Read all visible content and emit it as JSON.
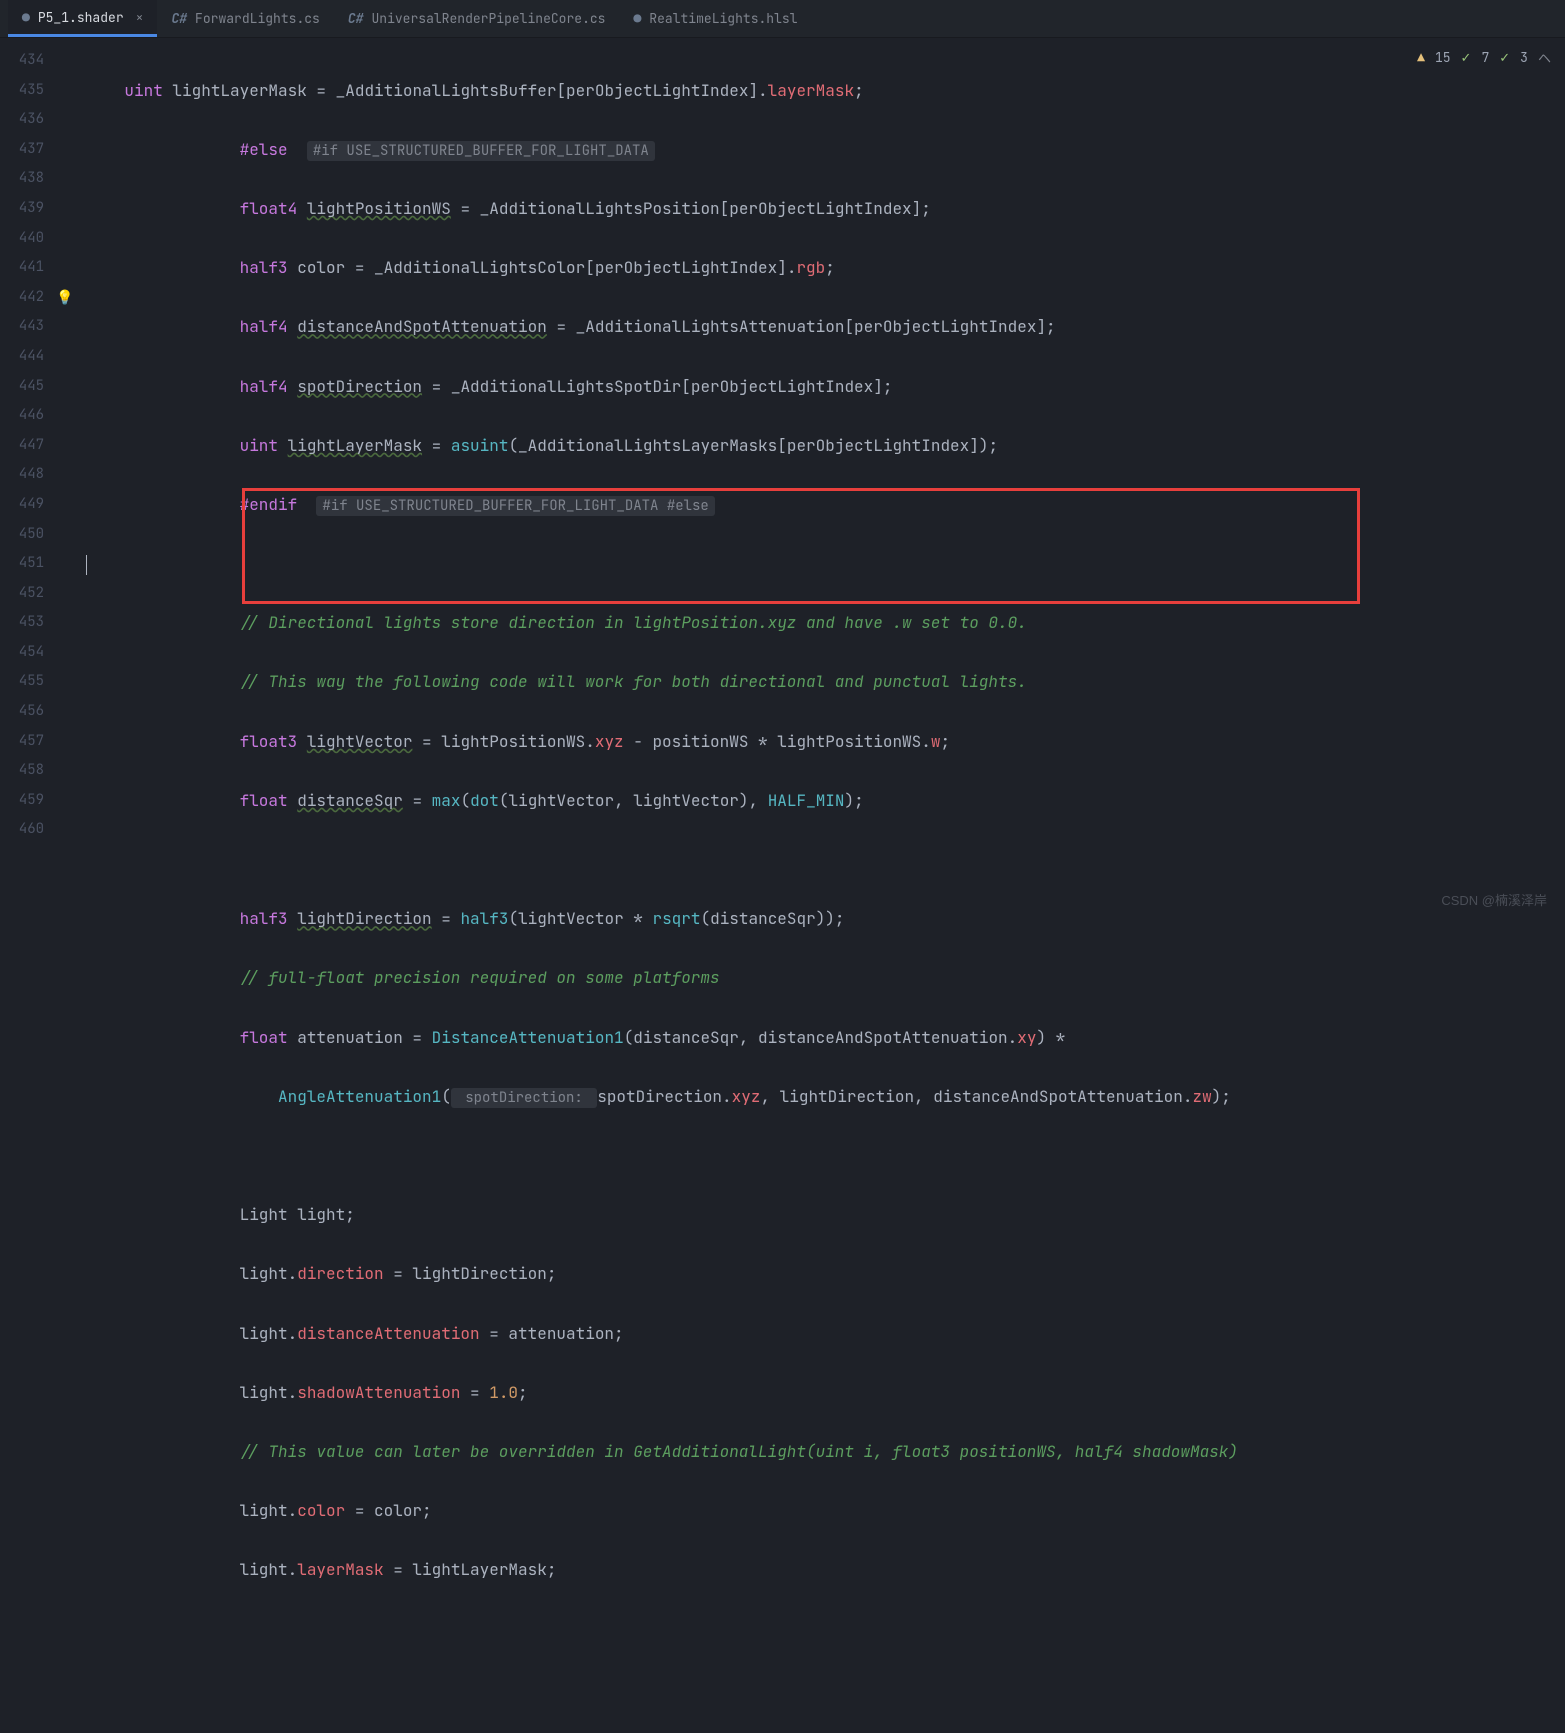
{
  "tabs": [
    {
      "label": "P5_1.shader",
      "icon": "●",
      "active": true,
      "closeable": true
    },
    {
      "label": "ForwardLights.cs",
      "icon": "C#",
      "active": false
    },
    {
      "label": "UniversalRenderPipelineCore.cs",
      "icon": "C#",
      "active": false
    },
    {
      "label": "RealtimeLights.hlsl",
      "icon": "●",
      "active": false
    }
  ],
  "status": {
    "warn_icon": "▲",
    "warn_count": "15",
    "check1_icon": "✓",
    "check1_count": "7",
    "check2_icon": "✓",
    "check2_count": "3",
    "chevron": "ヘ"
  },
  "gutter": {
    "start": 434,
    "end": 460,
    "bulb_line": 442
  },
  "code": {
    "l434": {
      "indent": "    ",
      "t1": "uint",
      "var": "lightLayerMask",
      "eq": " = ",
      "buf": "_AdditionalLightsBuffer",
      "mid": "[perObjectLightIndex].",
      "prop": "layerMask",
      "end": ";"
    },
    "l435": {
      "indent": "                ",
      "kw": "#else",
      "sp": "  ",
      "hint": "#if USE_STRUCTURED_BUFFER_FOR_LIGHT_DATA"
    },
    "l436": {
      "indent": "                ",
      "t": "float4",
      "sp": " ",
      "var": "lightPositionWS",
      "rest": " = _AdditionalLightsPosition[perObjectLightIndex];"
    },
    "l437": {
      "indent": "                ",
      "t": "half3",
      "sp": " ",
      "var": "color",
      "mid": " = _AdditionalLightsColor[perObjectLightIndex].",
      "prop": "rgb",
      "end": ";"
    },
    "l438": {
      "indent": "                ",
      "t": "half4",
      "sp": " ",
      "var": "distanceAndSpotAttenuation",
      "rest": " = _AdditionalLightsAttenuation[perObjectLightIndex];"
    },
    "l439": {
      "indent": "                ",
      "t": "half4",
      "sp": " ",
      "var": "spotDirection",
      "rest": " = _AdditionalLightsSpotDir[perObjectLightIndex];"
    },
    "l440": {
      "indent": "                ",
      "t": "uint",
      "sp": " ",
      "var": "lightLayerMask",
      "eq": " = ",
      "fn": "asuint",
      "rest": "(_AdditionalLightsLayerMasks[perObjectLightIndex]);"
    },
    "l441": {
      "indent": "                ",
      "kw": "#endif",
      "sp": "  ",
      "hint": "#if USE_STRUCTURED_BUFFER_FOR_LIGHT_DATA #else"
    },
    "l442": {
      "text": ""
    },
    "l443": {
      "indent": "                ",
      "c": "// Directional lights store direction in lightPosition.xyz and have .w set to 0.0."
    },
    "l444": {
      "indent": "                ",
      "c": "// This way the following code will work for both directional and punctual lights."
    },
    "l445": {
      "indent": "                ",
      "t": "float3",
      "sp": " ",
      "var": "lightVector",
      "mid1": " = lightPositionWS.",
      "p1": "xyz",
      "mid2": " - positionWS * lightPositionWS.",
      "p2": "w",
      "end": ";"
    },
    "l446": {
      "indent": "                ",
      "t": "float",
      "sp": " ",
      "var": "distanceSqr",
      "eq": " = ",
      "fn1": "max",
      "op": "(",
      "fn2": "dot",
      "args": "(lightVector, lightVector), ",
      "const": "HALF_MIN",
      "end": ");"
    },
    "l447": {
      "text": ""
    },
    "l448": {
      "indent": "                ",
      "t": "half3",
      "sp": " ",
      "var": "lightDirection",
      "eq": " = ",
      "fn1": "half3",
      "op": "(lightVector * ",
      "fn2": "rsqrt",
      "end": "(distanceSqr));"
    },
    "l449": {
      "indent": "                ",
      "c": "// full-float precision required on some platforms"
    },
    "l450": {
      "indent": "                ",
      "t": "float",
      "var": " attenuation = ",
      "fn": "DistanceAttenuation1",
      "args": "(distanceSqr, distanceAndSpotAttenuation.",
      "p": "xy",
      "end": ") *"
    },
    "l451": {
      "indent": "                    ",
      "fn": "AngleAttenuation1",
      "op": "(",
      "hint": " spotDirection: ",
      "args1": "spotDirection.",
      "p1": "xyz",
      "args2": ", lightDirection, distanceAndSpotAttenuation.",
      "p2": "zw",
      "end": ");"
    },
    "l452": {
      "text": ""
    },
    "l453": {
      "indent": "                ",
      "t": "Light",
      "rest": " light;"
    },
    "l454": {
      "indent": "                ",
      "pre": "light.",
      "prop": "direction",
      "rest": " = lightDirection;"
    },
    "l455": {
      "indent": "                ",
      "pre": "light.",
      "prop": "distanceAttenuation",
      "rest": " = attenuation;"
    },
    "l456": {
      "indent": "                ",
      "pre": "light.",
      "prop": "shadowAttenuation",
      "eq": " = ",
      "num": "1.0",
      "end": ";"
    },
    "l457": {
      "indent": "                ",
      "c": "// This value can later be overridden in GetAdditionalLight(uint i, float3 positionWS, half4 shadowMask)"
    },
    "l458": {
      "indent": "                ",
      "pre": "light.",
      "prop": "color",
      "rest": " = color;"
    },
    "l459": {
      "indent": "                ",
      "pre": "light.",
      "prop": "layerMask",
      "rest": " = lightLayerMask;"
    },
    "l460": {
      "text": ""
    }
  },
  "watermark": "CSDN @楠溪泽岸"
}
